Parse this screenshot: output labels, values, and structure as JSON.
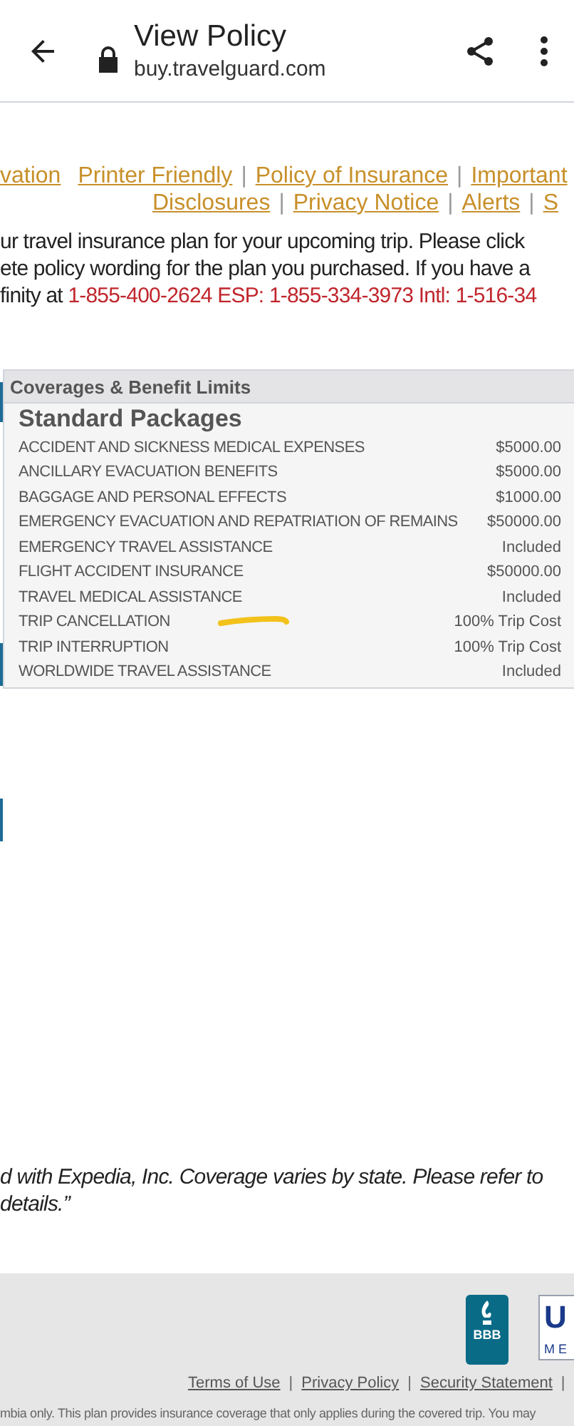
{
  "header": {
    "title": "View Policy",
    "url": "buy.travelguard.com"
  },
  "nav_links": [
    [
      {
        "kind": "link",
        "text": "vation"
      },
      {
        "kind": "link",
        "text": "Printer Friendly"
      },
      {
        "kind": "separator",
        "text": "|"
      },
      {
        "kind": "link",
        "text": "Policy of Insurance"
      },
      {
        "kind": "separator",
        "text": "|"
      },
      {
        "kind": "link",
        "text": "Important"
      }
    ],
    [
      {
        "kind": "link",
        "text": "Disclosures"
      },
      {
        "kind": "separator",
        "text": "|"
      },
      {
        "kind": "link",
        "text": "Privacy Notice"
      },
      {
        "kind": "separator",
        "text": "|"
      },
      {
        "kind": "link",
        "text": "Alerts"
      },
      {
        "kind": "separator",
        "text": "|"
      },
      {
        "kind": "link",
        "text": "S"
      }
    ]
  ],
  "intro_lines": [
    {
      "text": "ur travel insurance plan for your upcoming trip. Please click"
    },
    {
      "text": "ete policy wording for the plan you purchased. If you have a"
    },
    {
      "text": "finity at ",
      "phone": "1-855-400-2624 ESP: 1-855-334-3973 Intl: 1-516-34"
    }
  ],
  "coverage_table": {
    "header": "Coverages & Benefit Limits",
    "section": "Standard Packages",
    "rows": [
      {
        "benefit": "ACCIDENT AND SICKNESS MEDICAL EXPENSES",
        "limit": "$5000.00",
        "marked": false
      },
      {
        "benefit": "ANCILLARY EVACUATION BENEFITS",
        "limit": "$5000.00",
        "marked": false
      },
      {
        "benefit": "BAGGAGE AND PERSONAL EFFECTS",
        "limit": "$1000.00",
        "marked": false
      },
      {
        "benefit": "EMERGENCY EVACUATION AND REPATRIATION OF REMAINS",
        "limit": "$50000.00",
        "marked": false
      },
      {
        "benefit": "EMERGENCY TRAVEL ASSISTANCE",
        "limit": "Included",
        "marked": false
      },
      {
        "benefit": "FLIGHT ACCIDENT INSURANCE",
        "limit": "$50000.00",
        "marked": false
      },
      {
        "benefit": "TRAVEL MEDICAL ASSISTANCE",
        "limit": "Included",
        "marked": false
      },
      {
        "benefit": "TRIP CANCELLATION",
        "limit": "100% Trip Cost",
        "marked": true
      },
      {
        "benefit": "TRIP INTERRUPTION",
        "limit": "100% Trip Cost",
        "marked": false
      },
      {
        "benefit": "WORLDWIDE TRAVEL ASSISTANCE",
        "limit": "Included",
        "marked": false
      }
    ]
  },
  "disclaimer_lines": [
    "d with Expedia, Inc. Coverage varies by state. Please refer to",
    " details.”"
  ],
  "footer": {
    "badges": [
      {
        "kind": "bbb",
        "text": "BBB"
      },
      {
        "kind": "ustravel",
        "text": "U",
        "subtext": "M E"
      }
    ],
    "links": [
      {
        "kind": "link",
        "text": "Terms of Use"
      },
      {
        "kind": "separator",
        "text": "|"
      },
      {
        "kind": "link",
        "text": "Privacy Policy"
      },
      {
        "kind": "separator",
        "text": "|"
      },
      {
        "kind": "link",
        "text": "Security Statement"
      },
      {
        "kind": "separator",
        "text": "|"
      }
    ],
    "fine_print": "mbia only. This plan provides insurance coverage that only applies during the covered trip. You may"
  }
}
